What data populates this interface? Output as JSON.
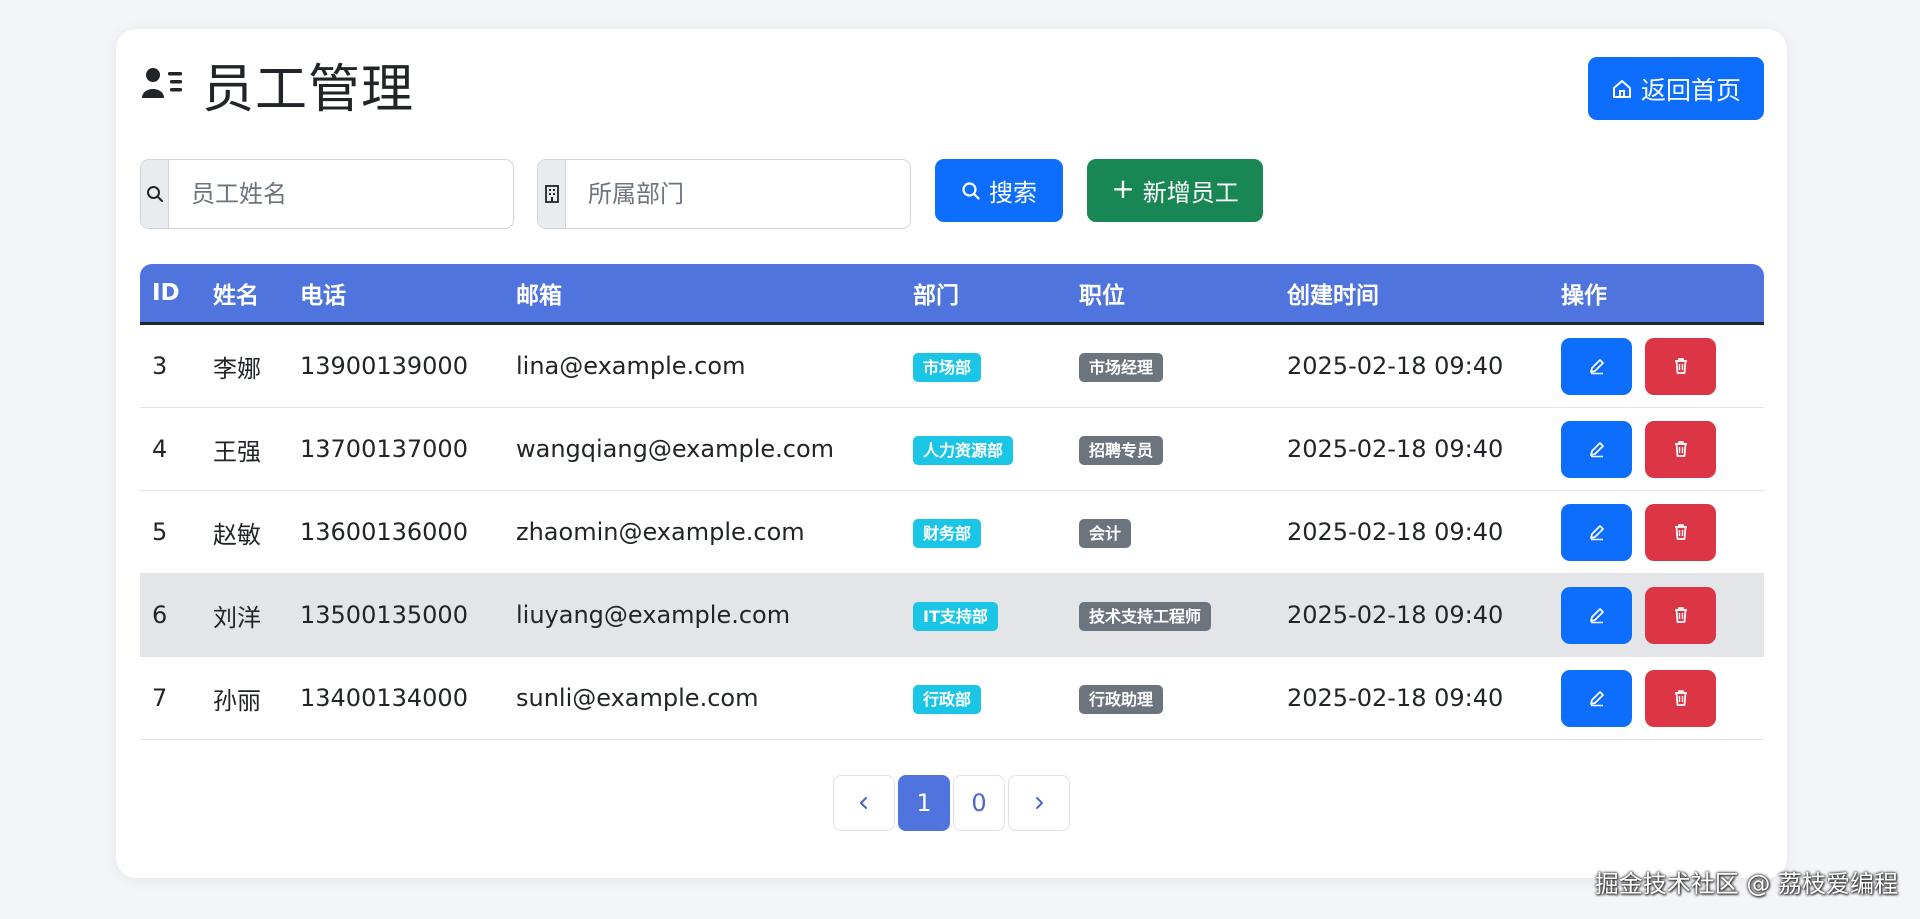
{
  "header": {
    "title": "员工管理",
    "home_button": "返回首页"
  },
  "search": {
    "name_placeholder": "员工姓名",
    "dept_placeholder": "所属部门",
    "search_button": "搜索",
    "add_button": "新增员工"
  },
  "table": {
    "columns": [
      "ID",
      "姓名",
      "电话",
      "邮箱",
      "部门",
      "职位",
      "创建时间",
      "操作"
    ],
    "rows": [
      {
        "id": "3",
        "name": "李娜",
        "phone": "13900139000",
        "email": "lina@example.com",
        "dept": "市场部",
        "position": "市场经理",
        "created": "2025-02-18 09:40"
      },
      {
        "id": "4",
        "name": "王强",
        "phone": "13700137000",
        "email": "wangqiang@example.com",
        "dept": "人力资源部",
        "position": "招聘专员",
        "created": "2025-02-18 09:40"
      },
      {
        "id": "5",
        "name": "赵敏",
        "phone": "13600136000",
        "email": "zhaomin@example.com",
        "dept": "财务部",
        "position": "会计",
        "created": "2025-02-18 09:40"
      },
      {
        "id": "6",
        "name": "刘洋",
        "phone": "13500135000",
        "email": "liuyang@example.com",
        "dept": "IT支持部",
        "position": "技术支持工程师",
        "created": "2025-02-18 09:40"
      },
      {
        "id": "7",
        "name": "孙丽",
        "phone": "13400134000",
        "email": "sunli@example.com",
        "dept": "行政部",
        "position": "行政助理",
        "created": "2025-02-18 09:40"
      }
    ]
  },
  "pagination": {
    "pages": [
      "1",
      "0"
    ],
    "active": "1"
  },
  "watermark": "掘金技术社区 @ 荔枝爱编程",
  "colors": {
    "primary": "#0d6efd",
    "success": "#198754",
    "danger": "#dc3545",
    "table_header": "#4f74de",
    "dept_badge": "#1bc5e6",
    "position_badge": "#6c757d"
  },
  "icons": {
    "title": "person-lines-icon",
    "home": "house-icon",
    "name_addon": "search-icon",
    "dept_addon": "building-icon",
    "search_button": "search-icon",
    "add_button": "plus-icon",
    "edit": "pencil-icon",
    "delete": "trash-icon",
    "prev": "chevron-left-icon",
    "next": "chevron-right-icon"
  }
}
